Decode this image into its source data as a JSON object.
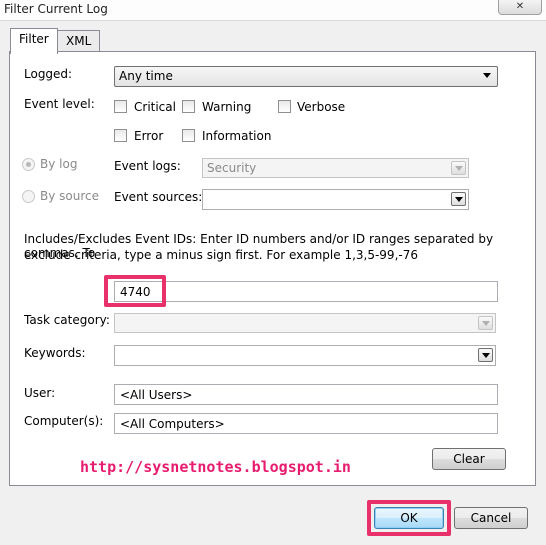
{
  "window": {
    "title": "Filter Current Log",
    "close_glyph": "✕"
  },
  "tabs": [
    {
      "label": "Filter"
    },
    {
      "label": "XML"
    }
  ],
  "logged": {
    "label": "Logged:",
    "value": "Any time"
  },
  "event_level": {
    "label": "Event level:",
    "options": [
      {
        "label": "Critical"
      },
      {
        "label": "Warning"
      },
      {
        "label": "Verbose"
      },
      {
        "label": "Error"
      },
      {
        "label": "Information"
      }
    ]
  },
  "by_log": {
    "label": "By log"
  },
  "by_source": {
    "label": "By source"
  },
  "event_logs": {
    "label": "Event logs:",
    "value": "Security"
  },
  "event_sources": {
    "label": "Event sources:",
    "value": ""
  },
  "event_ids": {
    "help_line1": "Includes/Excludes Event IDs: Enter ID numbers and/or ID ranges separated by commas. To",
    "help_line2": "exclude criteria, type a minus sign first. For example 1,3,5-99,-76",
    "value": "4740"
  },
  "task_category": {
    "label": "Task category:",
    "value": ""
  },
  "keywords": {
    "label": "Keywords:",
    "value": ""
  },
  "user": {
    "label": "User:",
    "value": "<All Users>"
  },
  "computers": {
    "label": "Computer(s):",
    "value": "<All Computers>"
  },
  "buttons": {
    "clear": "Clear",
    "ok": "OK",
    "cancel": "Cancel"
  },
  "watermark": "http://sysnetnotes.blogspot.in",
  "colors": {
    "highlight": "#e8306b",
    "watermark": "#e81c6e"
  }
}
